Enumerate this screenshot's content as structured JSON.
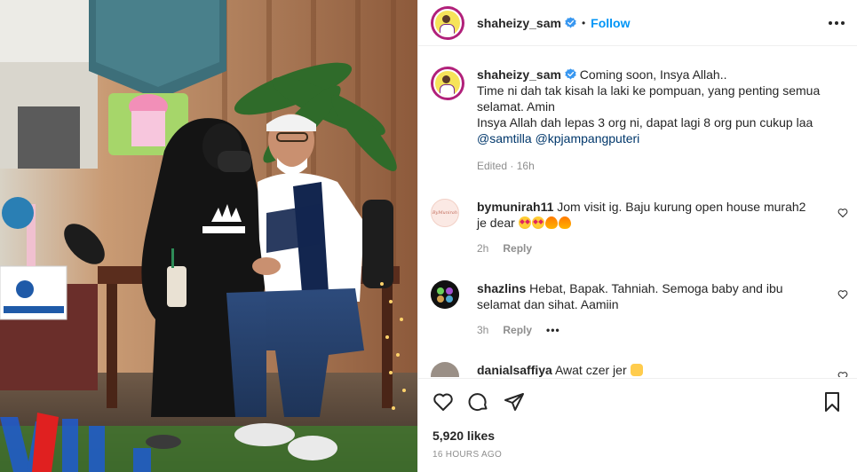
{
  "post": {
    "username": "shaheizy_sam",
    "follow_label": "Follow",
    "separator": "•",
    "caption_lines": [
      "Coming soon, Insya Allah..",
      "Time ni dah tak kisah la laki ke pompuan, yang penting semua selamat. Amin",
      "Insya Allah dah lepas 3 org ni, dapat lagi 8 org pun cukup laa"
    ],
    "mentions": [
      "@samtilla",
      "@kpjampangputeri"
    ],
    "edited_label": "Edited",
    "edited_sep": "·",
    "edited_time": "16h"
  },
  "comments": [
    {
      "username": "bymunirah11",
      "text": "Jom visit ig. Baju kurung open house murah2 je dear",
      "emojis": [
        "star-struck",
        "star-struck",
        "fire",
        "fire"
      ],
      "time": "2h",
      "reply_label": "Reply",
      "avatar_text": "ByMunirah",
      "more": ""
    },
    {
      "username": "shazlins",
      "text": "Hebat, Bapak. Tahniah. Semoga baby and ibu selamat dan sihat. Aamiin",
      "emojis": [],
      "time": "3h",
      "reply_label": "Reply",
      "more": "•••"
    },
    {
      "username": "danialsaffiya",
      "text": "Awat czer jer",
      "emojis": [
        "raised-hand"
      ],
      "time": "",
      "reply_label": "",
      "more": ""
    }
  ],
  "footer": {
    "likes": "5,920 likes",
    "time": "16 HOURS AGO"
  },
  "icons": {
    "verified": "verified-badge-icon",
    "more": "more-options-icon",
    "like": "heart-icon",
    "comment": "comment-icon",
    "share": "paper-plane-icon",
    "save": "bookmark-icon"
  },
  "colors": {
    "link": "#0095f6",
    "mention": "#00376b",
    "muted": "#8e8e8e",
    "text": "#262626"
  }
}
